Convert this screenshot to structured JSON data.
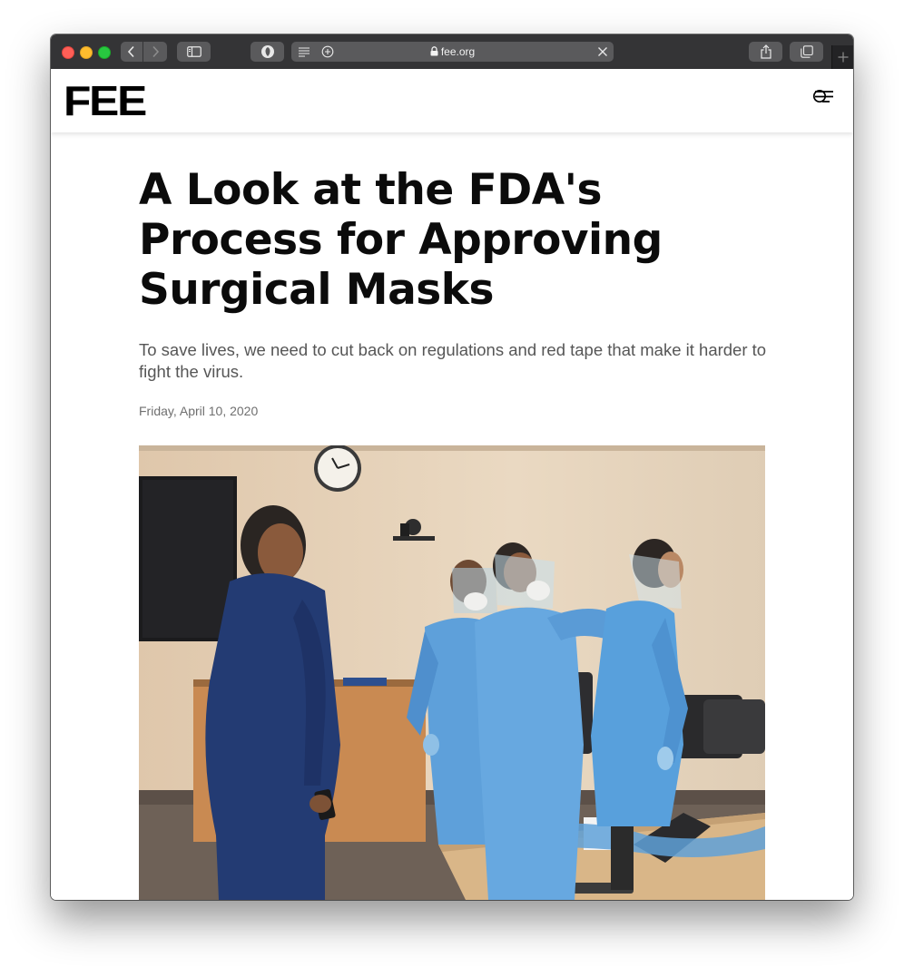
{
  "browser": {
    "url": "fee.org"
  },
  "site": {
    "logo": "FEE"
  },
  "article": {
    "title": "A Look at the FDA's Process for Approving Surgical Masks",
    "subtitle": "To save lives, we need to cut back on regulations and red tape that make it harder to fight the virus.",
    "date": "Friday, April 10, 2020"
  },
  "icons": {
    "back": "chevron-left-icon",
    "forward": "chevron-right-icon",
    "sidebar": "sidebar-icon",
    "extension": "privacy-shield-icon",
    "reader": "reader-icon",
    "add": "plus-circle-icon",
    "lock": "lock-icon",
    "close": "close-icon",
    "share": "share-icon",
    "tabs": "tabs-icon",
    "newtab": "plus-icon",
    "menu": "menu-icon"
  }
}
